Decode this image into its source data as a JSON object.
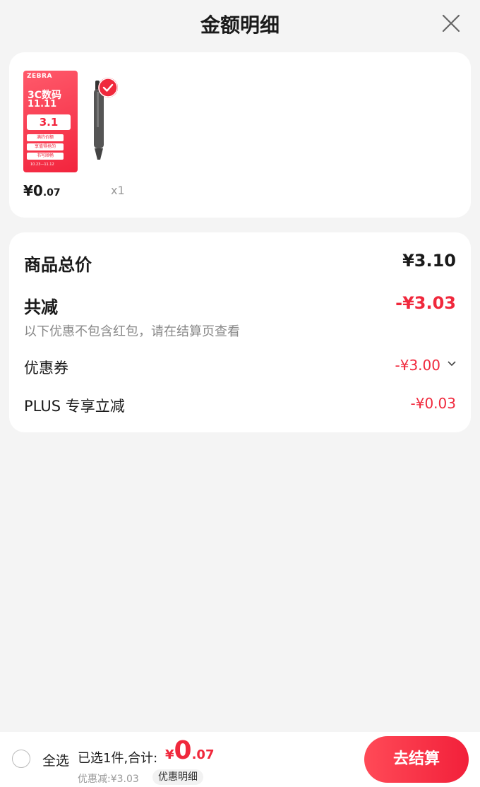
{
  "header": {
    "title": "金额明细",
    "close_icon": "close-icon"
  },
  "products": {
    "item1": {
      "brand": "ZEBRA",
      "promo_line1": "3C数码",
      "promo_line2": "11.11",
      "promo_badge": "3.1",
      "promo_lines": [
        "满约价额",
        "享值得抢的",
        "书写顺畅"
      ],
      "promo_date": "10.23—11.12",
      "price_int": "¥0",
      "price_dec": ".07"
    },
    "item2": {
      "quantity": "x1",
      "selected": true
    }
  },
  "summary": {
    "total_label": "商品总价",
    "total_value": "¥3.10",
    "reduce_label": "共减",
    "reduce_value": "-¥3.03",
    "note": "以下优惠不包含红包，请在结算页查看",
    "coupon_label": "优惠券",
    "coupon_value": "-¥3.00",
    "plus_label": "PLUS 专享立减",
    "plus_value": "-¥0.03"
  },
  "bottom_bar": {
    "select_all": "全选",
    "selected_count": "已选1件,合计:",
    "total_currency": "¥",
    "total_int": "0",
    "total_dec": ".07",
    "saved": "优惠减:¥3.03",
    "detail_button": "优惠明细",
    "checkout_button": "去结算"
  },
  "colors": {
    "accent": "#f0283c",
    "background": "#f4f4f4",
    "card": "#ffffff"
  }
}
